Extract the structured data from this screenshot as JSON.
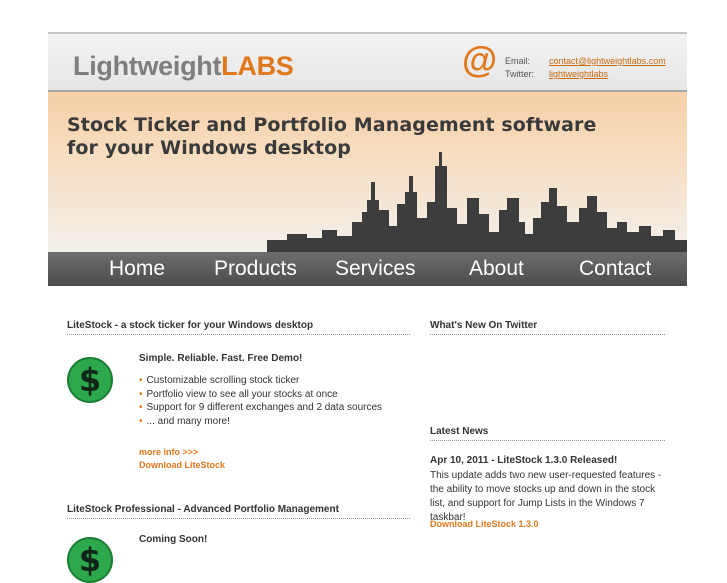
{
  "header": {
    "logo_part1": "Lightweight",
    "logo_part2": "LABS",
    "at_symbol": "@",
    "email_label": "Email:",
    "email_value": "contact@lightweightlabs.com",
    "twitter_label": "Twitter:",
    "twitter_value": "lightweightlabs"
  },
  "banner": {
    "tagline_line1": "Stock Ticker and Portfolio Management software",
    "tagline_line2": "for your Windows desktop"
  },
  "nav": {
    "items": [
      {
        "label": "Home"
      },
      {
        "label": "Products"
      },
      {
        "label": "Services"
      },
      {
        "label": "About"
      },
      {
        "label": "Contact"
      }
    ]
  },
  "main": {
    "product1": {
      "heading": "LiteStock - a stock ticker for your Windows desktop",
      "icon_glyph": "$",
      "title": "Simple. Reliable. Fast. Free Demo!",
      "features": [
        "Customizable scrolling stock ticker",
        "Portfolio view to see all your stocks at once",
        "Support for 9 different exchanges and 2 data sources",
        "... and many more!"
      ],
      "more_info": "more info >>>",
      "download": "Download LiteStock"
    },
    "product2": {
      "heading": "LiteStock Professional - Advanced Portfolio Management",
      "icon_glyph": "$",
      "title": "Coming Soon!"
    }
  },
  "sidebar": {
    "twitter_heading": "What's New On Twitter",
    "news_heading": "Latest News",
    "news_title": "Apr 10, 2011 - LiteStock 1.3.0 Released!",
    "news_body": "This update adds two new user-requested features - the ability to move stocks up and down in the stock list, and support for Jump Lists in the Windows 7 taskbar!",
    "news_link": "Download LiteStock 1.3.0"
  },
  "colors": {
    "accent": "#e0781e",
    "nav_bg": "#5a5a5a",
    "dollar_green": "#2ea84c"
  }
}
